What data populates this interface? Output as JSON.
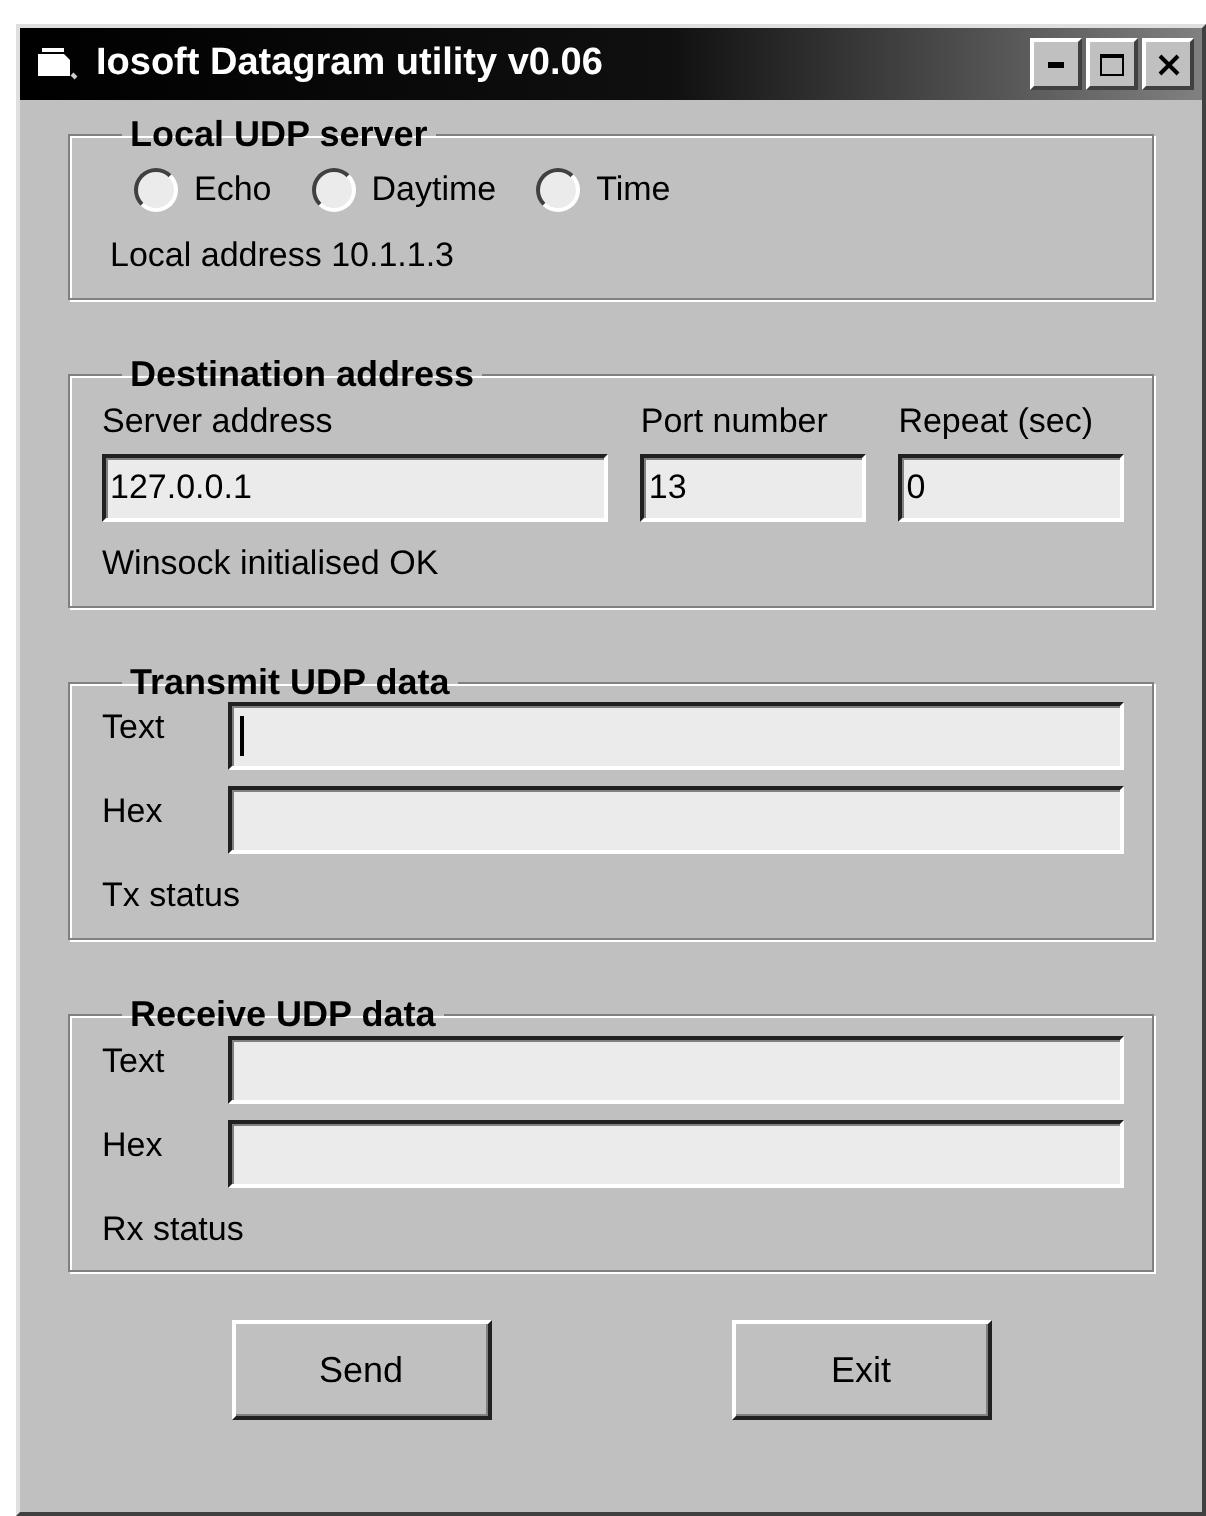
{
  "window": {
    "title": "Iosoft Datagram utility v0.06"
  },
  "local_server": {
    "title": "Local UDP server",
    "options": [
      {
        "label": "Echo",
        "selected": false
      },
      {
        "label": "Daytime",
        "selected": false
      },
      {
        "label": "Time",
        "selected": false
      }
    ],
    "status": "Local address 10.1.1.3"
  },
  "destination": {
    "title": "Destination address",
    "fields": [
      {
        "label": "Server address",
        "value": "127.0.0.1"
      },
      {
        "label": "Port number",
        "value": "13"
      },
      {
        "label": "Repeat (sec)",
        "value": "0"
      }
    ],
    "status": "Winsock initialised OK"
  },
  "data_groups": [
    {
      "title": "Transmit UDP data",
      "fields": [
        {
          "label": "Text",
          "focused": true
        },
        {
          "label": "Hex",
          "focused": false
        }
      ],
      "status": "Tx status"
    },
    {
      "title": "Receive UDP data",
      "fields": [
        {
          "label": "Text",
          "focused": false
        },
        {
          "label": "Hex",
          "focused": false
        }
      ],
      "status": "Rx status"
    }
  ],
  "buttons": [
    "Send",
    "Exit"
  ]
}
